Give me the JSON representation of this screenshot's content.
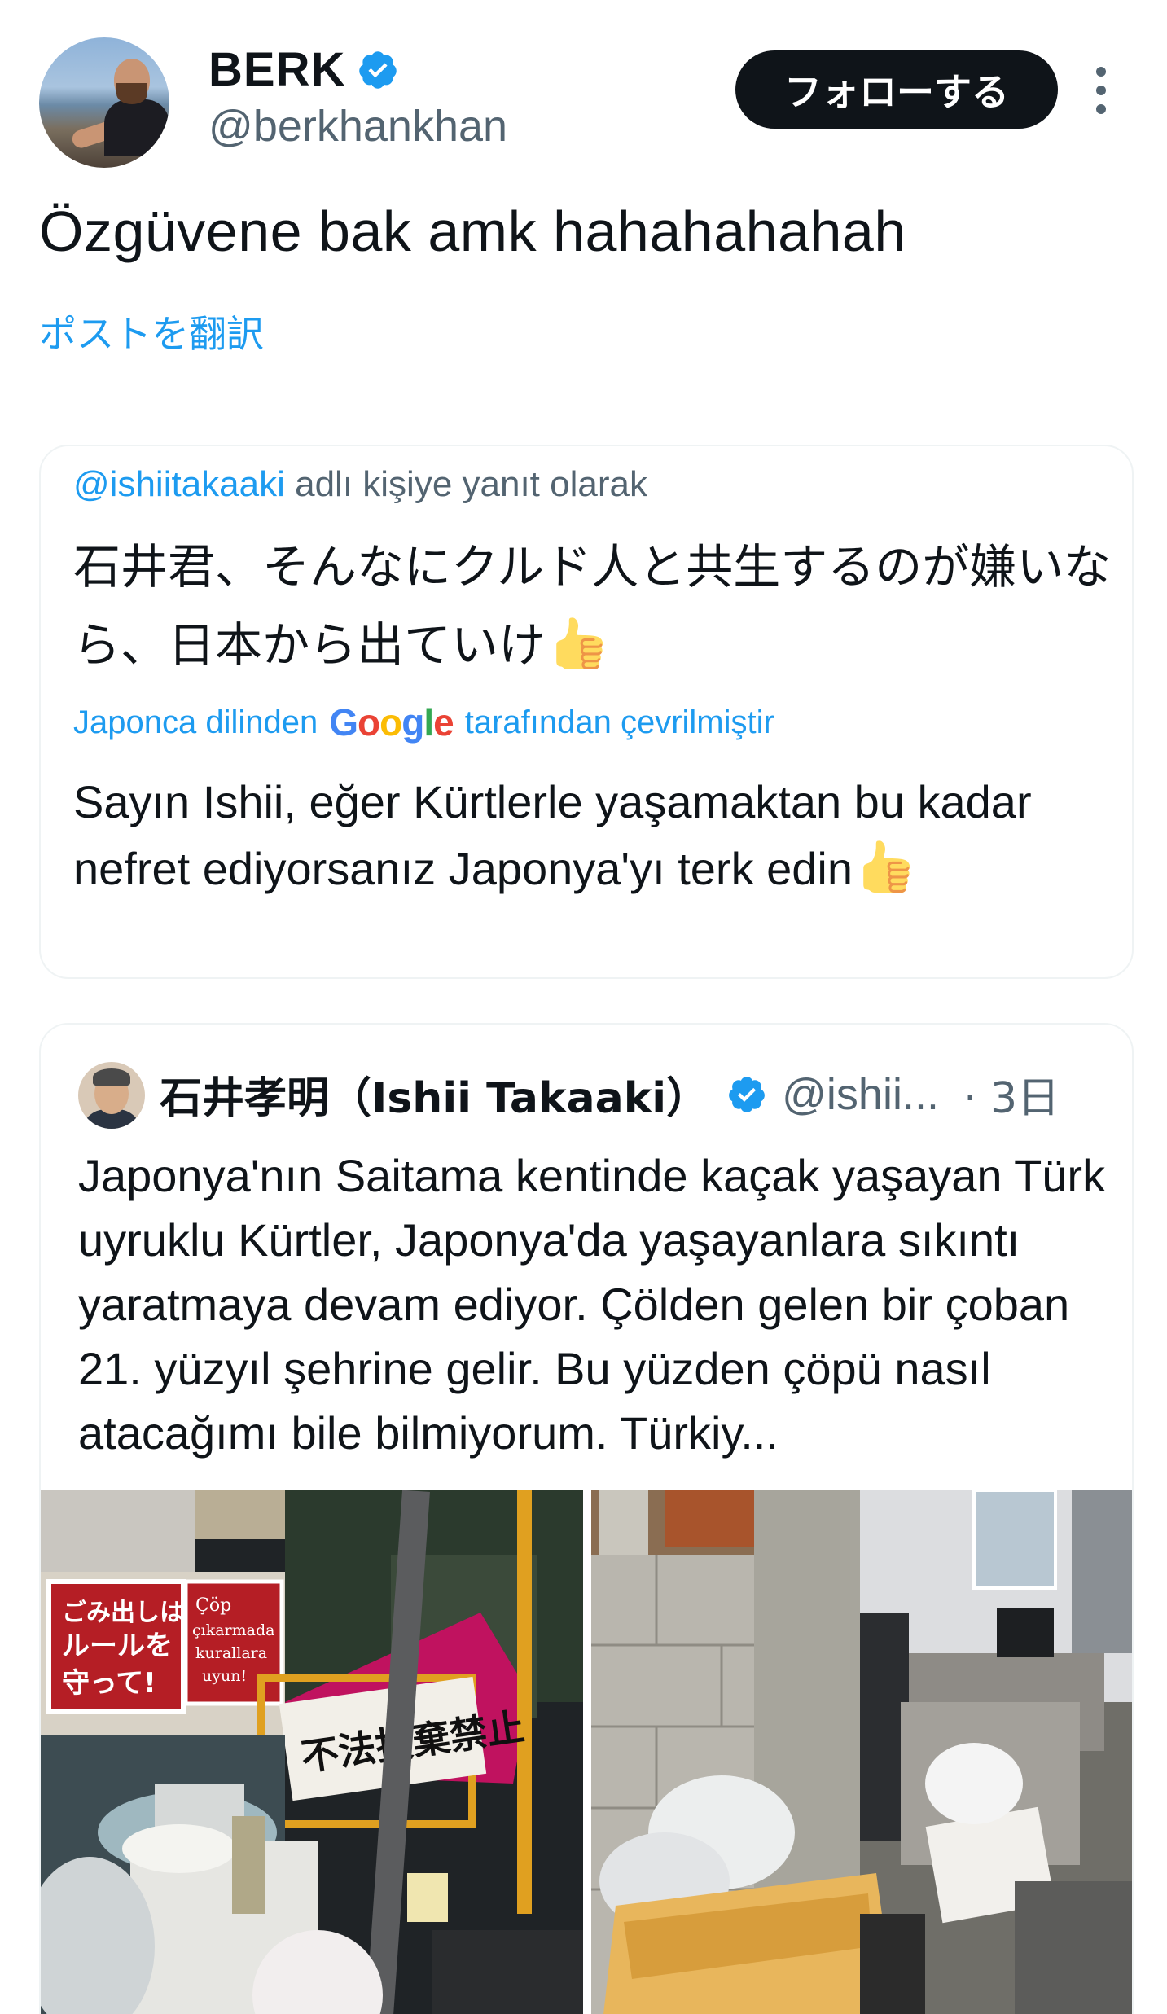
{
  "header": {
    "display_name": "BERK",
    "handle": "@berkhankhan",
    "follow_label": "フォローする"
  },
  "post": {
    "text": "Özgüvene bak amk hahahahahah",
    "translate_link": "ポストを翻訳"
  },
  "reply_card": {
    "mention": "@ishiitakaaki",
    "context_suffix": " adlı kişiye yanıt olarak",
    "original_text": "石井君、そんなにクルド人と共生するのが嫌いなら、日本から出ていけ",
    "translation_prefix": "Japonca dilinden",
    "translation_provider": "Google",
    "translation_suffix": "tarafından çevrilmiştir",
    "translated_text": "Sayın Ishii, eğer Kürtlerle yaşamaktan bu kadar nefret ediyorsanız Japonya'yı terk edin"
  },
  "quote_card": {
    "author_name": "石井孝明（Ishii Takaaki）",
    "handle": "@ishii...",
    "time": "· 3日",
    "text": "Japonya'nın Saitama kentinde kaçak yaşayan Türk uyruklu Kürtler, Japonya'da yaşayanlara sıkıntı yaratmaya devam ediyor. Çölden gelen bir çoban 21. yüzyıl şehrine gelir. Bu yüzden çöpü nasıl atacağımı bile bilmiyorum. Türkiy..."
  },
  "images": {
    "left_sign_1": "ごみ出しは\nルールを\n守って!",
    "left_sign_2": "Çöp\nçıkarmada\nkurallara\nuyun!",
    "left_banner": "不法投棄禁止"
  },
  "colors": {
    "accent": "#1d9bf0",
    "text": "#0f1419",
    "secondary": "#536471",
    "border": "#eff3f4"
  }
}
